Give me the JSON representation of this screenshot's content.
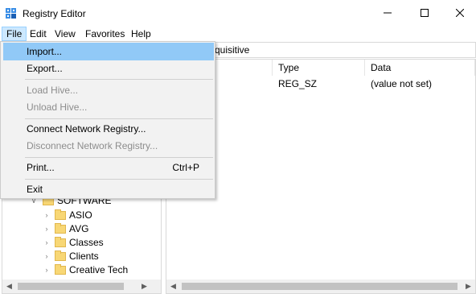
{
  "window": {
    "title": "Registry Editor",
    "icon": "registry-editor-icon",
    "controls": [
      "minimize-icon",
      "maximize-icon",
      "close-icon"
    ]
  },
  "menubar": {
    "items": [
      "File",
      "Edit",
      "View",
      "Favorites",
      "Help"
    ]
  },
  "address": {
    "visible_text": "quisitive"
  },
  "file_menu": {
    "import": "Import...",
    "export": "Export...",
    "load_hive": "Load Hive...",
    "unload_hive": "Unload Hive...",
    "connect_network": "Connect Network Registry...",
    "disconnect_network": "Disconnect Network Registry...",
    "print": "Print...",
    "print_shortcut": "Ctrl+P",
    "exit": "Exit"
  },
  "tree": {
    "parent": "SOFTWARE",
    "children": [
      "ASIO",
      "AVG",
      "Classes",
      "Clients",
      "Creative Tech"
    ]
  },
  "values": {
    "columns": [
      "Type",
      "Data"
    ],
    "rows": [
      {
        "name_partial": ")",
        "type": "REG_SZ",
        "data": "(value not set)"
      }
    ]
  },
  "colors": {
    "menu_highlight": "#91c9f7",
    "menu_file_active": "#cce8ff",
    "folder": "#f8d775",
    "disabled_text": "#8d8d8d"
  }
}
